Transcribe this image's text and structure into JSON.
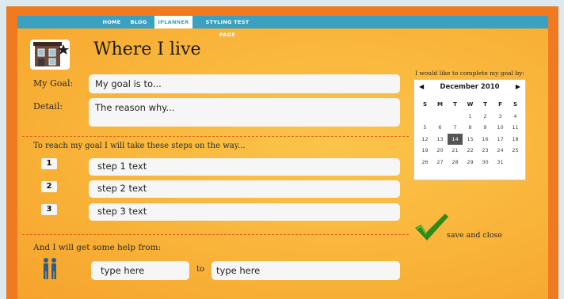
{
  "nav": {
    "items": [
      "HOME",
      "BLOG",
      "IPLANNER",
      "STYLING TEST PAGE"
    ]
  },
  "page_title": "Where I live",
  "goal": {
    "label": "My Goal:",
    "value": "My goal is to..."
  },
  "detail": {
    "label": "Detail:",
    "value": "The reason why..."
  },
  "steps": {
    "heading": "To reach my goal I will take these steps on the way...",
    "items": [
      {
        "num": "1",
        "text": "step 1 text"
      },
      {
        "num": "2",
        "text": "step 2 text"
      },
      {
        "num": "3",
        "text": "step 3 text"
      }
    ]
  },
  "help": {
    "heading": "And I will get some help from:",
    "from_value": "type here",
    "to_label": "to",
    "to_value": "type here"
  },
  "calendar": {
    "caption": "I would like to complete my goal by:",
    "month": "December 2010",
    "prev_arrow": "◀",
    "next_arrow": "▶",
    "day_headers": [
      "S",
      "M",
      "T",
      "W",
      "T",
      "F",
      "S"
    ],
    "weeks": [
      [
        "",
        "",
        "",
        "1",
        "2",
        "3",
        "4"
      ],
      [
        "5",
        "6",
        "7",
        "8",
        "9",
        "10",
        "11"
      ],
      [
        "12",
        "13",
        "14",
        "15",
        "16",
        "17",
        "18"
      ],
      [
        "19",
        "20",
        "21",
        "22",
        "23",
        "24",
        "25"
      ],
      [
        "26",
        "27",
        "28",
        "29",
        "30",
        "31",
        ""
      ]
    ],
    "selected": "14"
  },
  "save": {
    "label": "save and close"
  },
  "colors": {
    "frame": "#f07a20",
    "panel": "#f9b43a",
    "nav": "#3aa2c0",
    "checkmark": "#2f8a1a"
  }
}
